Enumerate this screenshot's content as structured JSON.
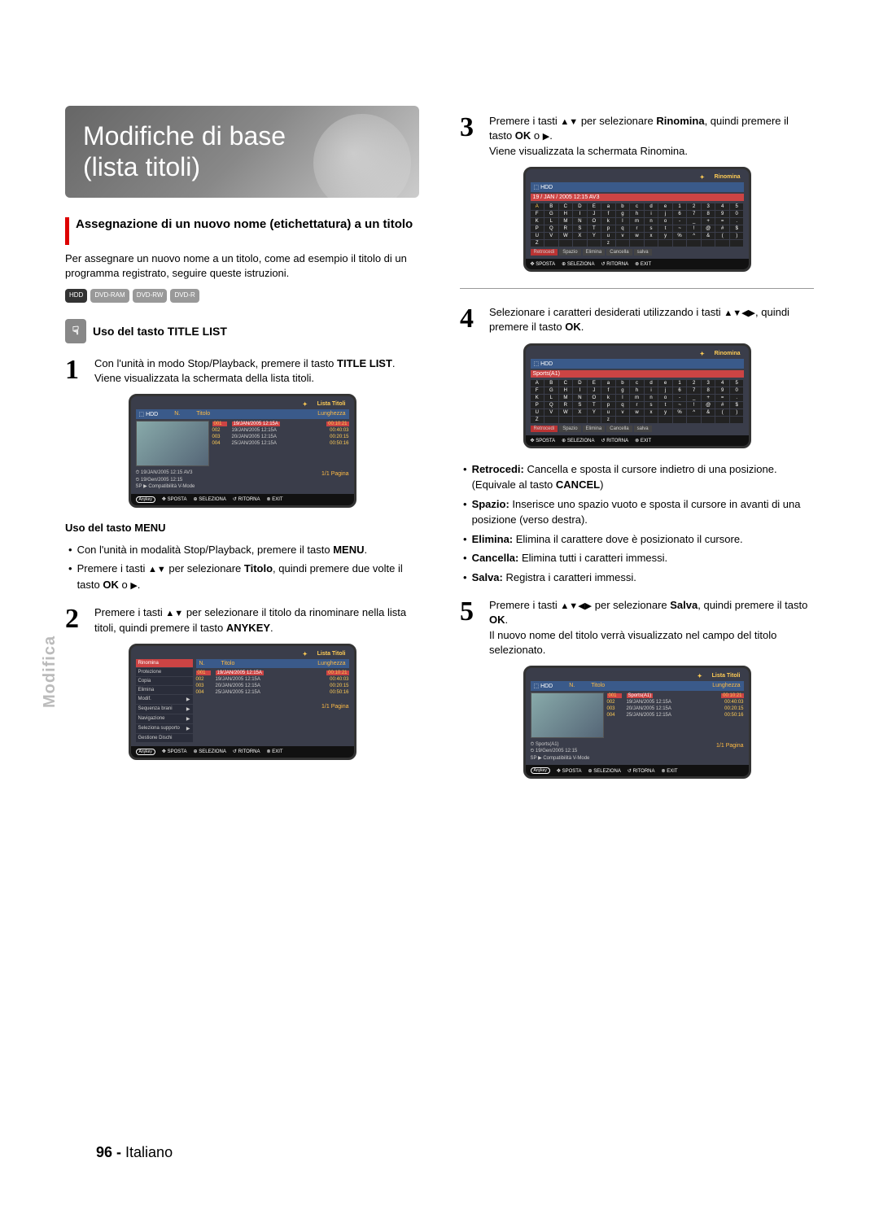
{
  "title_line1": "Modifiche di base",
  "title_line2": "(lista titoli)",
  "section_heading": "Assegnazione di un nuovo nome (etichettatura) a un titolo",
  "section_intro": "Per assegnare un nuovo nome a un titolo, come ad esempio il titolo di un programma registrato, seguire queste istruzioni.",
  "badges": {
    "hdd": "HDD",
    "ram": "DVD-RAM",
    "rw": "DVD-RW",
    "r": "DVD-R"
  },
  "sub_heading": "Uso del tasto TITLE LIST",
  "step1_a": "Con l'unità in modo Stop/Playback, premere il tasto ",
  "step1_b": "TITLE LIST",
  "step1_c": ".",
  "step1_d": "Viene visualizzata la schermata della lista titoli.",
  "menu_heading": "Uso del tasto MENU",
  "menu_b1_a": "Con l'unità in modalità Stop/Playback, premere il tasto ",
  "menu_b1_b": "MENU",
  "menu_b1_c": ".",
  "menu_b2_a": "Premere i tasti ",
  "menu_b2_b": " per selezionare ",
  "menu_b2_c": "Titolo",
  "menu_b2_d": ", quindi premere due volte il tasto ",
  "menu_b2_e": "OK",
  "menu_b2_f": " o ",
  "step2_a": "Premere i tasti ",
  "step2_b": " per selezionare il titolo da rinominare nella lista titoli, quindi premere il tasto ",
  "step2_c": "ANYKEY",
  "step2_d": ".",
  "step3_a": "Premere i tasti ",
  "step3_b": " per selezionare ",
  "step3_c": "Rinomina",
  "step3_d": ", quindi premere il tasto ",
  "step3_e": "OK",
  "step3_f": " o ",
  "step3_g": "Viene visualizzata la schermata Rinomina.",
  "step4_a": "Selezionare i caratteri desiderati utilizzando i tasti ",
  "step4_b": ", quindi premere il tasto ",
  "step4_c": "OK",
  "step4_d": ".",
  "defs": {
    "retrocedi_t": "Retrocedi:",
    "retrocedi": " Cancella e sposta il cursore indietro di una posizione. (Equivale al tasto ",
    "retrocedi_b": "CANCEL",
    "retrocedi_c": ")",
    "spazio_t": "Spazio:",
    "spazio": " Inserisce uno spazio vuoto e sposta il cursore in avanti di una posizione (verso destra).",
    "elimina_t": "Elimina:",
    "elimina": " Elimina il carattere dove è posizionato il cursore.",
    "cancella_t": "Cancella:",
    "cancella": " Elimina tutti i caratteri immessi.",
    "salva_t": "Salva:",
    "salva": " Registra i caratteri immessi."
  },
  "step5_a": "Premere i tasti ",
  "step5_b": " per selezionare ",
  "step5_c": "Salva",
  "step5_d": ", quindi premere il tasto ",
  "step5_e": "OK",
  "step5_f": ".",
  "step5_g": "Il nuovo nome del titolo verrà visualizzato nel campo del titolo selezionato.",
  "side_tab": "Modifica",
  "footer_page": "96 -",
  "footer_lang": " Italiano",
  "shot_common": {
    "hdr_list": "Lista Titoli",
    "hdr_rename": "Rinomina",
    "hdd": "HDD",
    "cols_n": "N.",
    "cols_title": "Titolo",
    "cols_len": "Lunghezza",
    "rows": [
      {
        "n": "001",
        "t": "19/JAN/2005 12:15A",
        "l": "00:10:21"
      },
      {
        "n": "002",
        "t": "19/JAN/2005 12:15A",
        "l": "00:40:03"
      },
      {
        "n": "003",
        "t": "20/JAN/2005 12:15A",
        "l": "00:20:15"
      },
      {
        "n": "004",
        "t": "25/JAN/2005 12:15A",
        "l": "00:50:16"
      }
    ],
    "meta1": "19/JAN/2005 12:15 AV3",
    "meta2": "19/Gen/2005 12:15",
    "meta3": "SP ▶ Compatibilità V-Mode",
    "pagina": "1/1 Pagina",
    "foot_sposta": "SPOSTA",
    "foot_sel": "SELEZIONA",
    "foot_rit": "RITORNA",
    "foot_exit": "EXIT",
    "anykey": "Anykey"
  },
  "shot_menu": {
    "items": [
      "Rinomina",
      "Protezione",
      "Copia",
      "Elimina",
      "Modif.",
      "Sequenza brani",
      "Navigazione",
      "Seleziona supporto",
      "Gestione Dischi"
    ],
    "hl": "Rinomina"
  },
  "shot_rename": {
    "title_old": "19 / JAN / 2005 12:15 AV3",
    "title_new": "Sports(A1)",
    "buttons": [
      "Retrocedi",
      "Spazio",
      "Elimina",
      "Cancella",
      "salva"
    ]
  },
  "shot_final_row1": {
    "n": "001",
    "t": "Sports(A1)",
    "l": "00:10:21"
  }
}
